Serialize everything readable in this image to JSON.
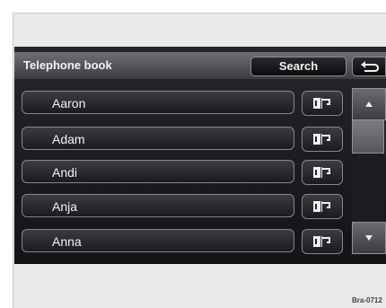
{
  "header": {
    "title": "Telephone book",
    "search_label": "Search"
  },
  "contacts": [
    {
      "name": "Aaron"
    },
    {
      "name": "Adam"
    },
    {
      "name": "Andi"
    },
    {
      "name": "Anja"
    },
    {
      "name": "Anna"
    }
  ],
  "icons": {
    "back": "back-arrow-icon",
    "info": "contact-card-icon",
    "up": "arrow-up-icon",
    "down": "arrow-down-icon"
  },
  "colors": {
    "screen": "#1e1e22",
    "button_border": "#85878b",
    "text": "#f2f2f2"
  },
  "scrollbar": {
    "position": 0
  },
  "footer": {
    "image_ref": "Bra-0712"
  }
}
